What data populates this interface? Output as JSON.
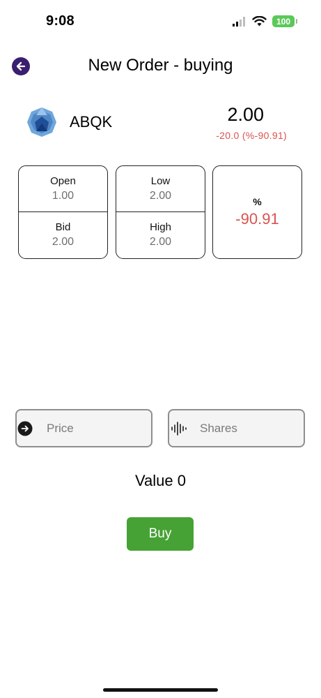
{
  "status_bar": {
    "time": "9:08",
    "battery": "100"
  },
  "header": {
    "title": "New Order - buying"
  },
  "stock": {
    "ticker": "ABQK",
    "price": "2.00",
    "change": "-20.0 (%-90.91)",
    "change_color": "#d9534f"
  },
  "stats": {
    "open": {
      "label": "Open",
      "value": "1.00"
    },
    "bid": {
      "label": "Bid",
      "value": "2.00"
    },
    "low": {
      "label": "Low",
      "value": "2.00"
    },
    "high": {
      "label": "High",
      "value": "2.00"
    },
    "percent": {
      "label": "%",
      "value": "-90.91"
    }
  },
  "order_form": {
    "price_placeholder": "Price",
    "shares_placeholder": "Shares",
    "value_text": "Value 0",
    "buy_label": "Buy",
    "buy_color": "#46a234"
  }
}
